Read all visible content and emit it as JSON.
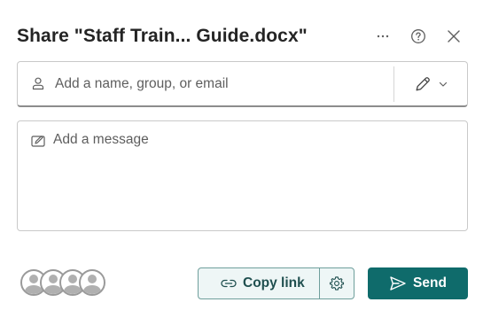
{
  "dialog": {
    "title": "Share \"Staff Train... Guide.docx\"",
    "more_icon": "more-horizontal-icon",
    "help_icon": "help-circle-icon",
    "close_icon": "close-icon"
  },
  "people": {
    "value": "",
    "placeholder": "Add a name, group, or email",
    "icon": "person-icon",
    "permission_icon": "pencil-edit-icon",
    "permission_caret_icon": "chevron-down-icon"
  },
  "message": {
    "value": "",
    "placeholder": "Add a message",
    "icon": "compose-message-icon"
  },
  "footer": {
    "avatars_count": 4,
    "copy_link_label": "Copy link",
    "copy_link_icon": "link-icon",
    "settings_icon": "gear-icon",
    "send_label": "Send",
    "send_icon": "send-icon"
  },
  "colors": {
    "accent": "#0f6b6b",
    "copy_border": "#6f9f9c",
    "copy_bg": "#eef6f6",
    "text": "#242424",
    "placeholder": "#5e5e5e"
  }
}
